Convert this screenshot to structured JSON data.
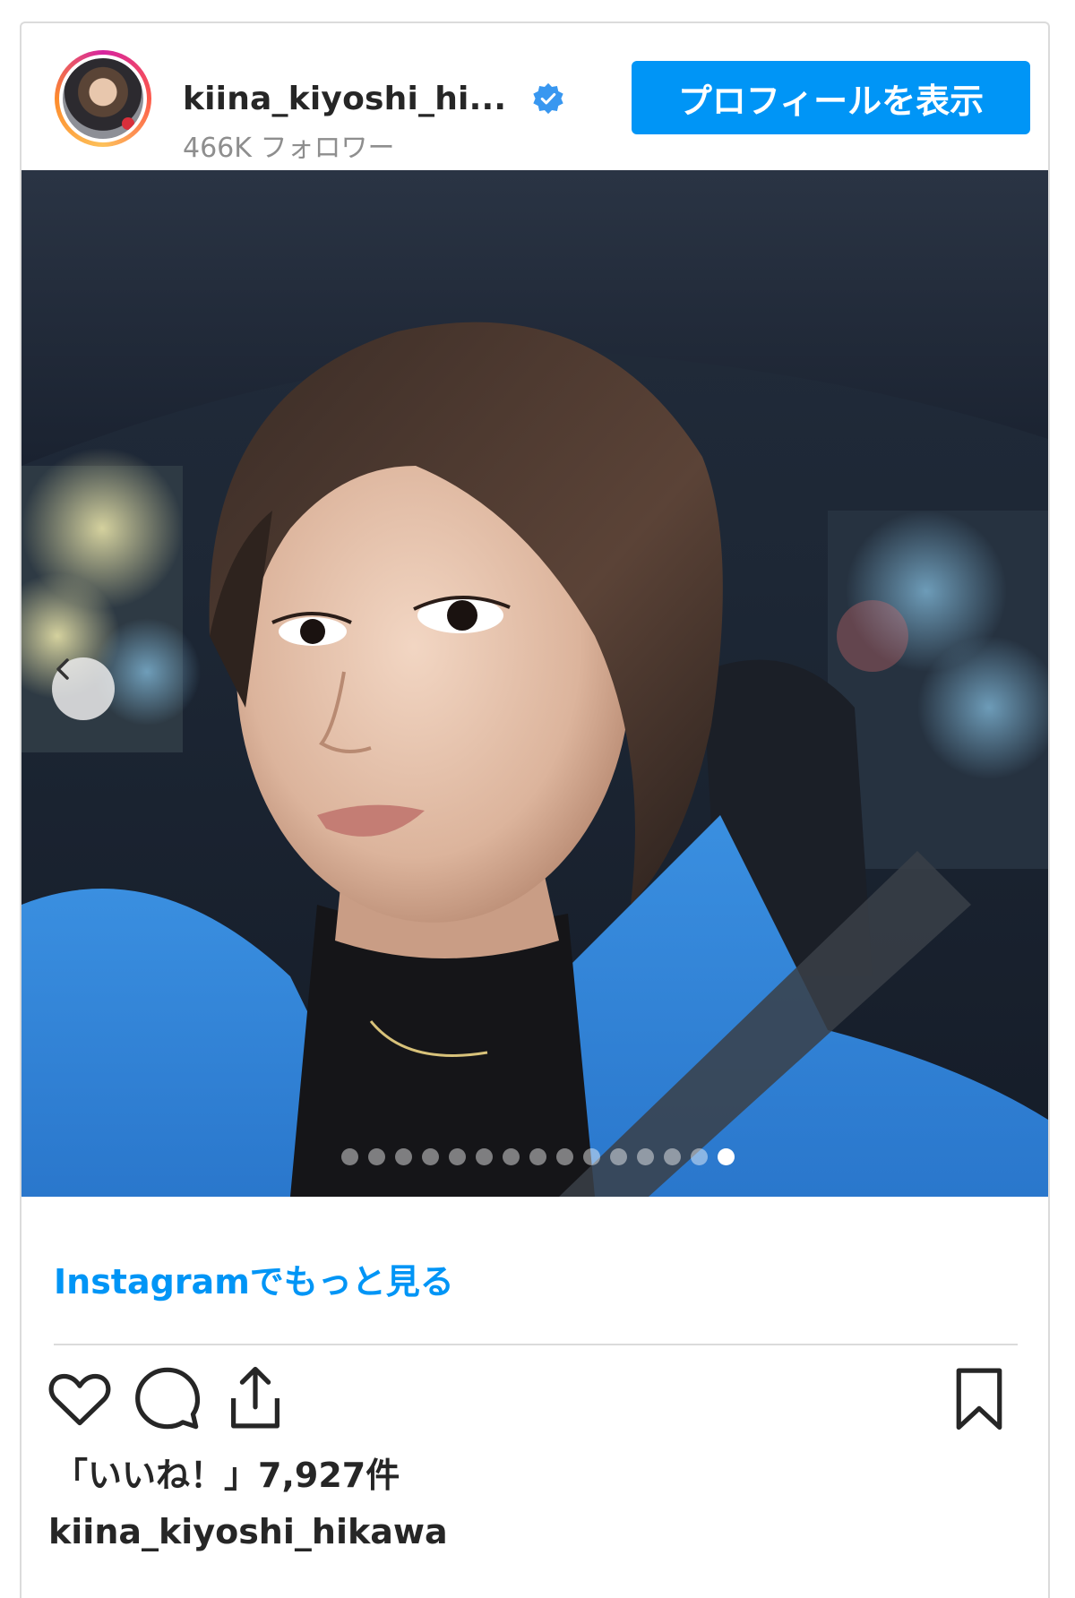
{
  "header": {
    "username": "kiina_kiyoshi_hi...",
    "followers": "466K フォロワー",
    "profile_button": "プロフィールを表示",
    "verified_icon": "verified-badge-icon"
  },
  "carousel": {
    "total_slides": 15,
    "active_index": 14,
    "prev_icon": "chevron-left-icon"
  },
  "more_link": "Instagramでもっと見る",
  "actions": {
    "like_icon": "heart-icon",
    "comment_icon": "comment-icon",
    "share_icon": "share-icon",
    "save_icon": "bookmark-icon"
  },
  "likes_text": "「いいね！」7,927件",
  "caption_username": "kiina_kiyoshi_hikawa",
  "colors": {
    "accent": "#0095f6",
    "text": "#262626",
    "muted": "#8e8e8e",
    "border": "#dbdbdb"
  }
}
